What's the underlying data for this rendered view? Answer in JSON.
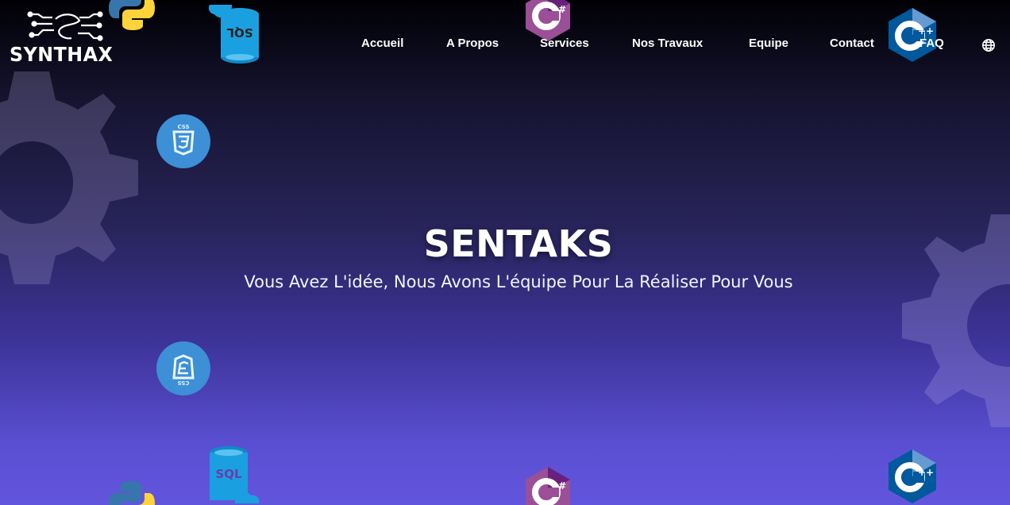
{
  "brand": {
    "name": "SYNTHAX"
  },
  "nav": {
    "items": [
      {
        "label": "Accueil"
      },
      {
        "label": "A Propos"
      },
      {
        "label": "Services"
      },
      {
        "label": "Nos Travaux"
      },
      {
        "label": "Equipe"
      },
      {
        "label": "Contact"
      },
      {
        "label": "FAQ"
      }
    ],
    "language_icon": "globe-icon"
  },
  "hero": {
    "title": "SENTAKS",
    "subtitle": "Vous Avez L'idée, Nous Avons L'équipe Pour La Réaliser Pour Vous"
  },
  "tech_icons": {
    "sql_label": "SQL",
    "css_label": "CSS",
    "csharp_label": "C#",
    "cpp_label": "C++"
  },
  "colors": {
    "background_top": "#000004",
    "background_bottom": "#6255dd",
    "text": "#ffffff",
    "css_blue": "#3d8fd6",
    "sql_blue": "#1aa0e0",
    "csharp_purple": "#9b4f96",
    "cpp_blue": "#00599c",
    "python_blue": "#3776ab",
    "python_yellow": "#ffd43b"
  }
}
